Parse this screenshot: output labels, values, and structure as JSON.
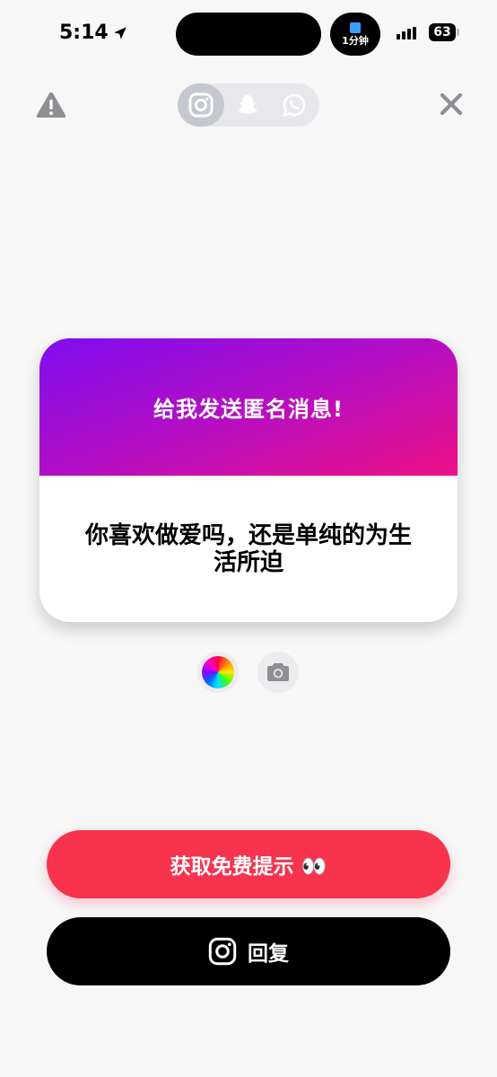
{
  "status_bar": {
    "time": "5:14",
    "live_activity": "1分钟",
    "battery": "63"
  },
  "card": {
    "title": "给我发送匿名消息!",
    "message": "你喜欢做爱吗，还是单纯的为生活所迫"
  },
  "buttons": {
    "hint": "获取免费提示 👀",
    "reply": "回复"
  },
  "icons": {
    "warning": "warning-icon",
    "instagram": "instagram-icon",
    "snapchat": "snapchat-icon",
    "whatsapp": "whatsapp-icon",
    "close": "close-icon",
    "color": "color-wheel-icon",
    "camera": "camera-icon"
  },
  "colors": {
    "hint_button": "#f7334d",
    "reply_button": "#000000",
    "gradient_start": "#7f0df0",
    "gradient_end": "#ee1186"
  }
}
